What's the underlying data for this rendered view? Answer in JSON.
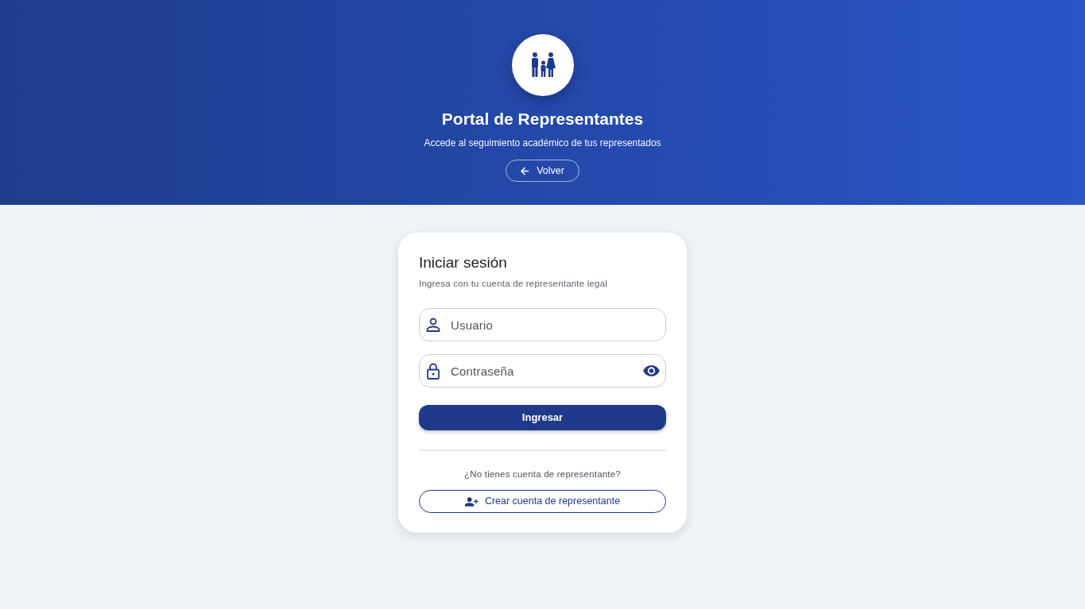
{
  "header": {
    "title": "Portal de Representantes",
    "subtitle": "Accede al seguimiento académico de tus representados",
    "back_button": "Volver"
  },
  "login_card": {
    "title": "Iniciar sesión",
    "subtitle": "Ingresa con tu cuenta de representante legal",
    "fields": [
      {
        "kind": "text",
        "placeholder": "Usuario"
      },
      {
        "kind": "password",
        "placeholder": "Contraseña"
      }
    ],
    "submit_button": "Ingresar",
    "signup_prompt": "¿No tienes cuenta de representante?",
    "signup_button": "Crear cuenta de representante"
  }
}
